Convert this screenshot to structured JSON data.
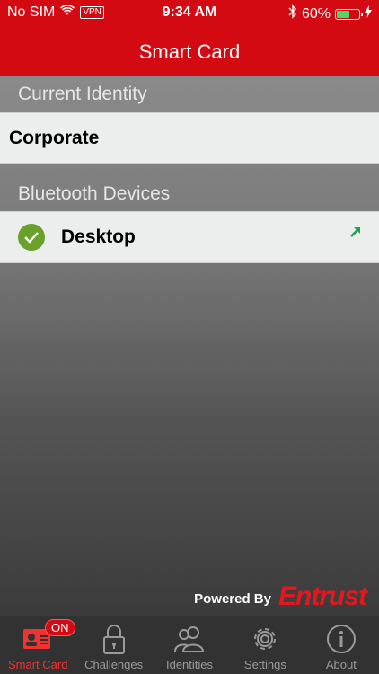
{
  "status_bar": {
    "carrier": "No SIM",
    "vpn": "VPN",
    "time": "9:34 AM",
    "battery": "60%",
    "battery_level": 0.6
  },
  "nav": {
    "title": "Smart Card"
  },
  "sections": {
    "current_identity": "Current Identity",
    "identity_value": "Corporate",
    "bluetooth": "Bluetooth Devices",
    "device_name": "Desktop"
  },
  "footer": {
    "powered_by": "Powered By",
    "brand": "Entrust"
  },
  "tabs": [
    {
      "label": "Smart Card",
      "icon": "smart-card-icon",
      "badge": "ON",
      "active": true
    },
    {
      "label": "Challenges",
      "icon": "lock-icon",
      "active": false
    },
    {
      "label": "Identities",
      "icon": "people-icon",
      "active": false
    },
    {
      "label": "Settings",
      "icon": "gear-icon",
      "active": false
    },
    {
      "label": "About",
      "icon": "info-icon",
      "active": false
    }
  ],
  "colors": {
    "brand_red": "#d40a12",
    "check_green": "#6aa12b",
    "arrow_green": "#1fa34a"
  }
}
